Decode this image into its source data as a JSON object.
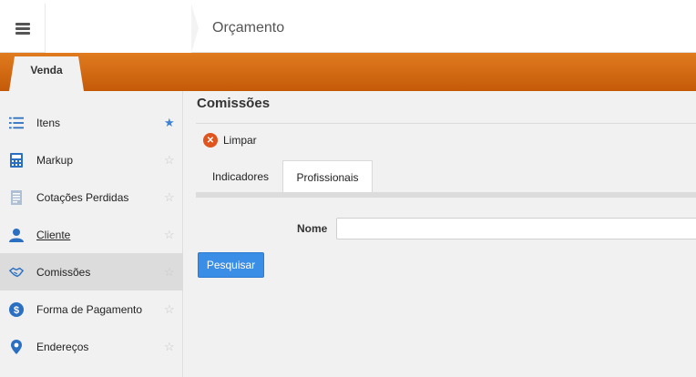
{
  "header": {
    "title": "Orçamento"
  },
  "tabs_top": [
    {
      "label": "Venda"
    }
  ],
  "sidebar": {
    "items": [
      {
        "label": "Itens",
        "icon": "list-icon",
        "starred": true
      },
      {
        "label": "Markup",
        "icon": "calculator-icon",
        "starred": false
      },
      {
        "label": "Cotações Perdidas",
        "icon": "document-icon",
        "starred": false
      },
      {
        "label": "Cliente",
        "icon": "user-icon",
        "starred": false
      },
      {
        "label": "Comissões",
        "icon": "handshake-icon",
        "starred": false,
        "active": true
      },
      {
        "label": "Forma de Pagamento",
        "icon": "dollar-icon",
        "starred": false
      },
      {
        "label": "Endereços",
        "icon": "map-marker-icon",
        "starred": false
      }
    ]
  },
  "main": {
    "section_title": "Comissões",
    "clear_label": "Limpar",
    "tabs": [
      {
        "label": "Indicadores"
      },
      {
        "label": "Profissionais",
        "active": true
      }
    ],
    "form": {
      "nome_label": "Nome",
      "nome_value": ""
    },
    "search_button": "Pesquisar"
  },
  "colors": {
    "accent_orange": "#d4670f",
    "star_active": "#3b82d6",
    "button_blue": "#3a8ee6",
    "clear_red": "#e0541d"
  }
}
